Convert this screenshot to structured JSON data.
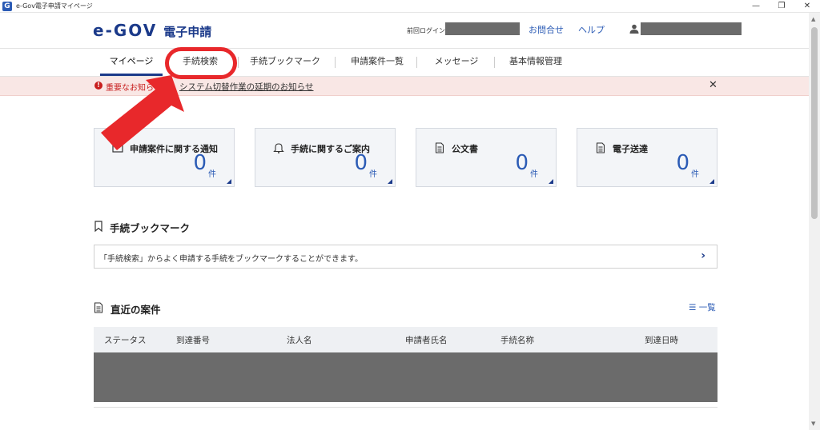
{
  "window": {
    "title": "e-Gov電子申請マイページ",
    "icon_letter": "G",
    "controls": [
      "—",
      "❐",
      "✕"
    ]
  },
  "header": {
    "logo_main": "e-GOV",
    "logo_sub": "電子申請",
    "last_login_label": "前回ログイン",
    "contact_link": "お問合せ",
    "help_link": "ヘルプ"
  },
  "nav": {
    "tabs": [
      {
        "label": "マイページ"
      },
      {
        "label": "手続検索"
      },
      {
        "label": "手続ブックマーク"
      },
      {
        "label": "申請案件一覧"
      },
      {
        "label": "メッセージ"
      },
      {
        "label": "基本情報管理"
      }
    ],
    "active_index": 0
  },
  "notice": {
    "icon": "!",
    "label": "重要なお知らせ",
    "link": "システム切替作業の延期のお知らせ",
    "close": "✕"
  },
  "cards": [
    {
      "title": "申請案件に関する通知",
      "count": "0",
      "unit": "件",
      "icon": "mail-icon"
    },
    {
      "title": "手続に関するご案内",
      "count": "0",
      "unit": "件",
      "icon": "bell-icon"
    },
    {
      "title": "公文書",
      "count": "0",
      "unit": "件",
      "icon": "document-icon"
    },
    {
      "title": "電子送達",
      "count": "0",
      "unit": "件",
      "icon": "document-icon"
    }
  ],
  "bookmark_section": {
    "title": "手続ブックマーク",
    "message": "「手続検索」からよく申請する手続をブックマークすることができます。",
    "chevron": "›"
  },
  "recent_section": {
    "title": "直近の案件",
    "list_link": "一覧",
    "columns": [
      "ステータス",
      "到達番号",
      "法人名",
      "申請者氏名",
      "手続名称",
      "到達日時"
    ]
  },
  "colors": {
    "brand": "#1b3a8a",
    "link": "#2b5bb5",
    "alert": "#c81e1e",
    "annotation": "#e8282b"
  }
}
